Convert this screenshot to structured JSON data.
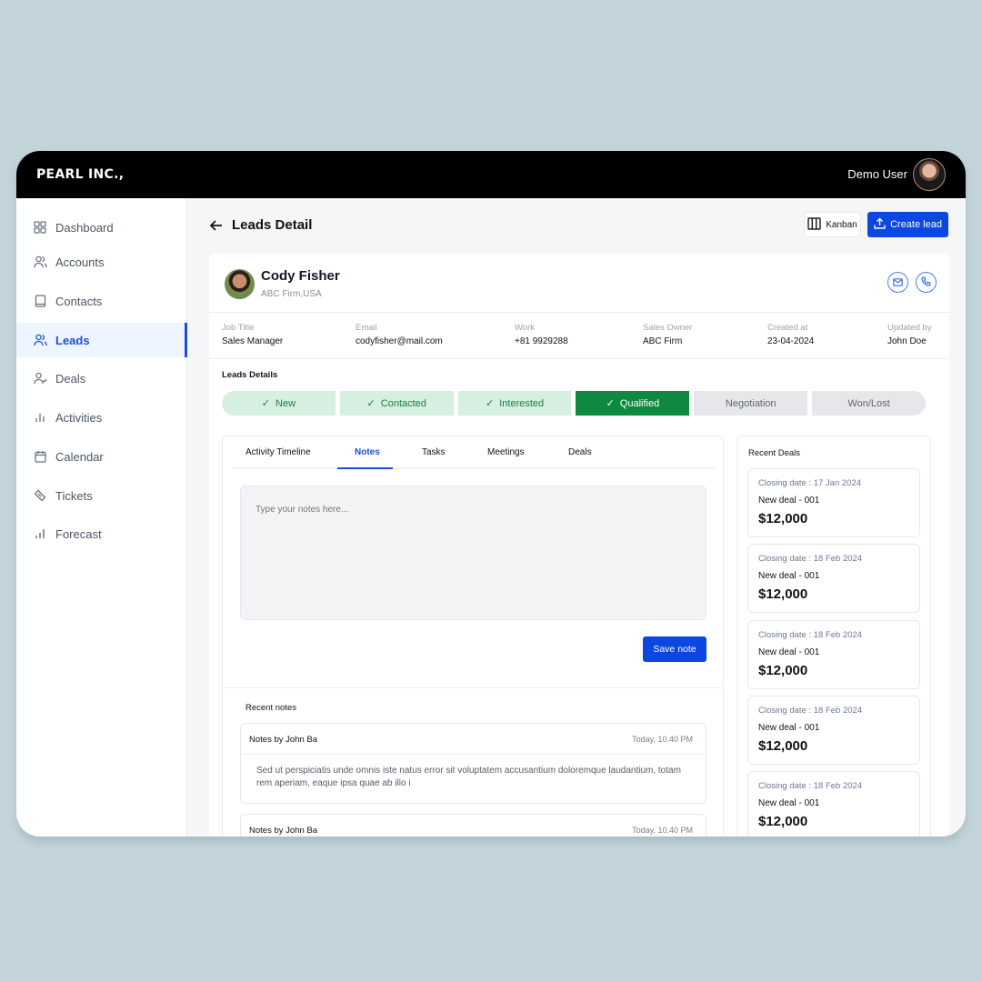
{
  "topbar": {
    "brand": "PEARL INC.,",
    "user_name": "Demo User"
  },
  "sidebar": {
    "items": [
      {
        "label": "Dashboard",
        "icon": "grid-icon"
      },
      {
        "label": "Accounts",
        "icon": "users-icon"
      },
      {
        "label": "Contacts",
        "icon": "book-icon"
      },
      {
        "label": "Leads",
        "icon": "users-icon",
        "active": true
      },
      {
        "label": "Deals",
        "icon": "user-check-icon"
      },
      {
        "label": "Activities",
        "icon": "bar-chart-icon"
      },
      {
        "label": "Calendar",
        "icon": "calendar-icon"
      },
      {
        "label": "Tickets",
        "icon": "ticket-icon"
      },
      {
        "label": "Forecast",
        "icon": "signal-icon"
      }
    ]
  },
  "header": {
    "title": "Leads Detail",
    "kanban_label": "Kanban",
    "create_label": "Create lead"
  },
  "lead": {
    "name": "Cody Fisher",
    "company": "ABC Firm,USA",
    "fields": [
      {
        "label": "Job Title",
        "value": "Sales Manager"
      },
      {
        "label": "Email",
        "value": "codyfisher@mail.com"
      },
      {
        "label": "Work",
        "value": "+81 9929288"
      },
      {
        "label": "Sales Owner",
        "value": "ABC Firm"
      },
      {
        "label": "Created at",
        "value": "23-04-2024"
      },
      {
        "label": "Updated by",
        "value": "John Doe"
      }
    ]
  },
  "stages": {
    "title": "Leads Details",
    "items": [
      {
        "label": "New",
        "state": "done"
      },
      {
        "label": "Contacted",
        "state": "done"
      },
      {
        "label": "Interested",
        "state": "done"
      },
      {
        "label": "Qualified",
        "state": "current"
      },
      {
        "label": "Negotiation",
        "state": "pending"
      },
      {
        "label": "Won/Lost",
        "state": "pending"
      }
    ]
  },
  "tabs": {
    "items": [
      "Activity Timeline",
      "Notes",
      "Tasks",
      "Meetings",
      "Deals"
    ],
    "active": "Notes"
  },
  "notes": {
    "placeholder": "Type your notes here...",
    "value": "",
    "save_label": "Save note",
    "recent_title": "Recent notes",
    "items": [
      {
        "author": "Notes by John Ba",
        "time": "Today, 10.40 PM",
        "body": "Sed ut perspiciatis unde omnis iste natus error sit voluptatem accusantium doloremque laudantium, totam rem aperiam, eaque ipsa quae ab illo i"
      },
      {
        "author": "Notes by John Ba",
        "time": "Today, 10.40 PM",
        "body": ""
      }
    ]
  },
  "recent_deals": {
    "title": "Recent Deals",
    "items": [
      {
        "date": "Closing date : 17 Jan 2024",
        "name": "New deal - 001",
        "amount": "$12,000"
      },
      {
        "date": "Closing date : 18 Feb 2024",
        "name": "New deal - 001",
        "amount": "$12,000"
      },
      {
        "date": "Closing date : 18 Feb 2024",
        "name": "New deal - 001",
        "amount": "$12,000"
      },
      {
        "date": "Closing date : 18 Feb 2024",
        "name": "New deal - 001",
        "amount": "$12,000"
      },
      {
        "date": "Closing date : 18 Feb 2024",
        "name": "New deal - 001",
        "amount": "$12,000"
      }
    ]
  },
  "colors": {
    "accent": "#0b47e0",
    "stage_done": "#d7efe1",
    "stage_current": "#0d8a3f",
    "stage_pending": "#e6e7ea"
  }
}
